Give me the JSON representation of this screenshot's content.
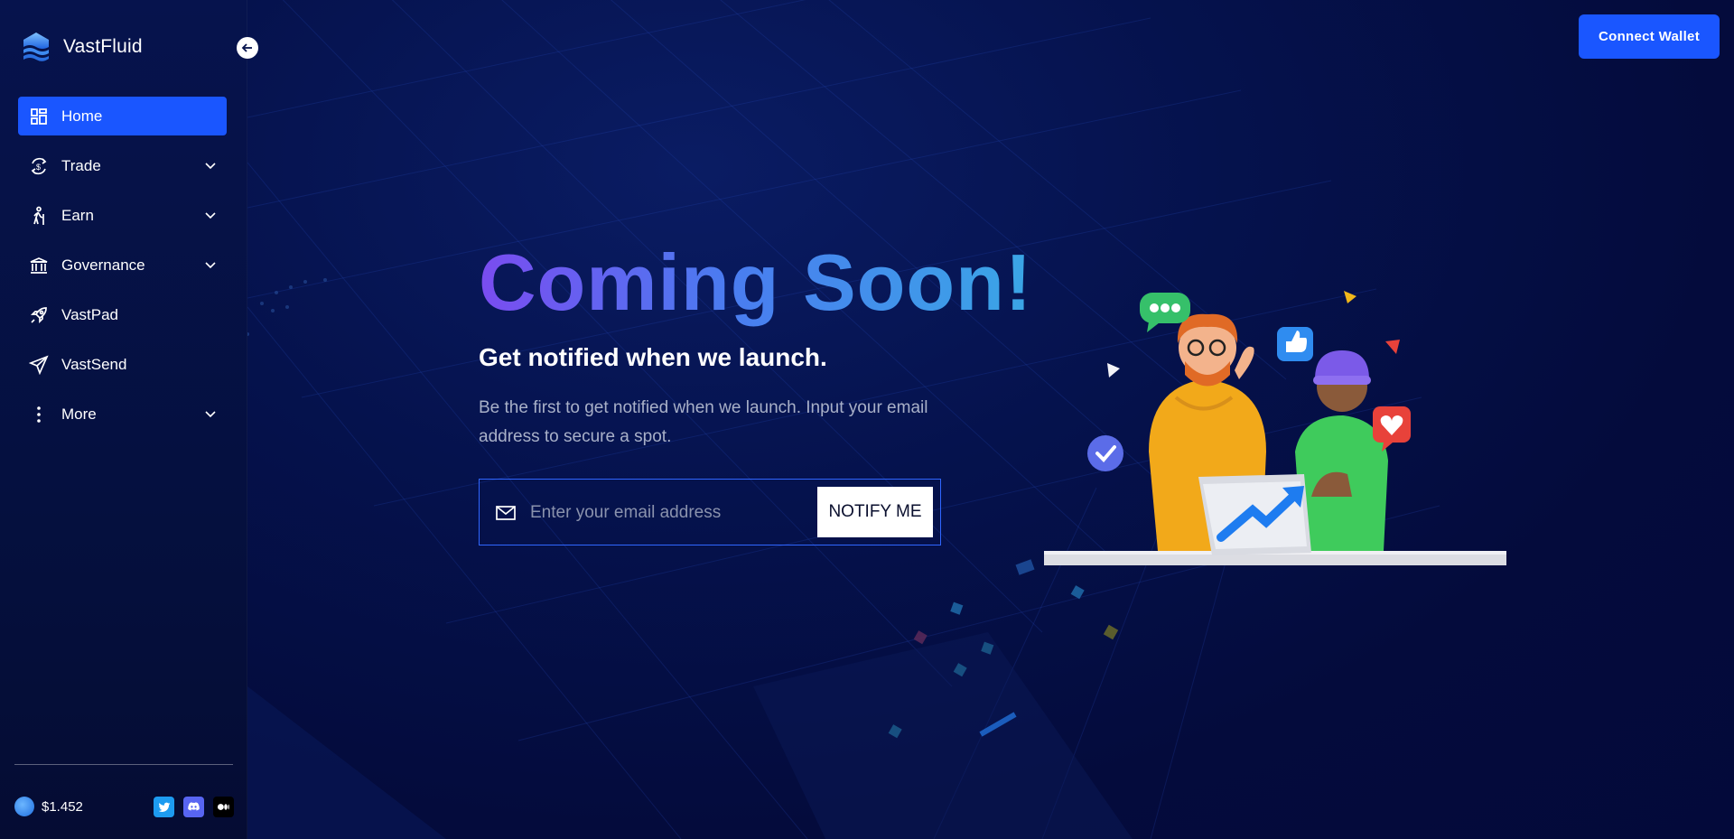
{
  "brand": {
    "name": "VastFluid"
  },
  "sidebar": {
    "items": [
      {
        "label": "Home",
        "icon": "dashboard-icon",
        "active": true,
        "expandable": false
      },
      {
        "label": "Trade",
        "icon": "swap-icon",
        "active": false,
        "expandable": true
      },
      {
        "label": "Earn",
        "icon": "hiker-icon",
        "active": false,
        "expandable": true
      },
      {
        "label": "Governance",
        "icon": "bank-icon",
        "active": false,
        "expandable": true
      },
      {
        "label": "VastPad",
        "icon": "rocket-icon",
        "active": false,
        "expandable": false
      },
      {
        "label": "VastSend",
        "icon": "send-icon",
        "active": false,
        "expandable": false
      },
      {
        "label": "More",
        "icon": "more-vertical-icon",
        "active": false,
        "expandable": true
      }
    ],
    "price": "$1.452",
    "socials": [
      "twitter-icon",
      "discord-icon",
      "medium-icon"
    ]
  },
  "header": {
    "connect_label": "Connect Wallet"
  },
  "hero": {
    "title": "Coming Soon!",
    "subtitle": "Get notified when we launch.",
    "description": "Be the first to get notified when we launch. Input your email address to secure a spot.",
    "email_placeholder": "Enter your email address",
    "notify_label": "NOTIFY ME"
  },
  "colors": {
    "accent": "#1a56ff",
    "background": "#040d3f",
    "sidebar": "#06134d",
    "title_gradient": [
      "#7a4cf0",
      "#3aa6e6"
    ]
  }
}
